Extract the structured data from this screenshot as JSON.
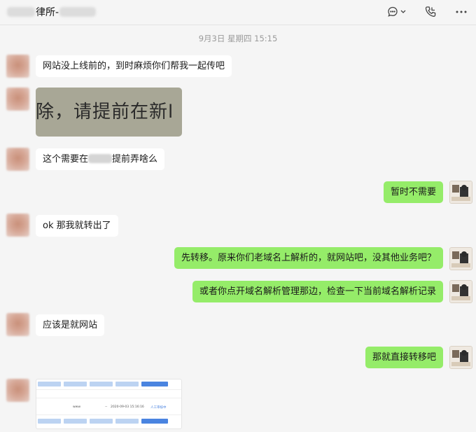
{
  "header": {
    "title_mid": "律所-",
    "icons": [
      "chat-bubble-icon",
      "chevron-down-icon",
      "phone-icon",
      "more-icon"
    ]
  },
  "timestamp": "9月3日 星期四 15:15",
  "messages": [
    {
      "side": "in",
      "text": "网站没上线前的，到时麻烦你们帮我一起传吧"
    },
    {
      "side": "in",
      "type": "image",
      "image_text": "除，请提前在新l"
    },
    {
      "side": "in",
      "text_before": "这个需要在",
      "text_after": "提前弄啥么"
    },
    {
      "side": "out",
      "text": "暂时不需要"
    },
    {
      "side": "in",
      "text": "ok 那我就转出了"
    },
    {
      "side": "out",
      "text": "先转移。原来你们老域名上解析的，就网站吧，没其他业务吧？"
    },
    {
      "side": "out",
      "text": "或者你点开域名解析管理那边，检查一下当前域名解析记录"
    },
    {
      "side": "in",
      "text": "应该是就网站"
    },
    {
      "side": "out",
      "text": "那就直接转移吧"
    },
    {
      "side": "in",
      "type": "image",
      "image_text": "screenshot"
    }
  ],
  "screenshot": {
    "cells": [
      "www",
      "--",
      "2020-09-03 15:16:16",
      "人工审核中"
    ]
  },
  "colors": {
    "bg": "#f5f5f5",
    "bubble_in": "#ffffff",
    "bubble_out": "#95ec69",
    "timestamp": "#9a9a9a"
  }
}
